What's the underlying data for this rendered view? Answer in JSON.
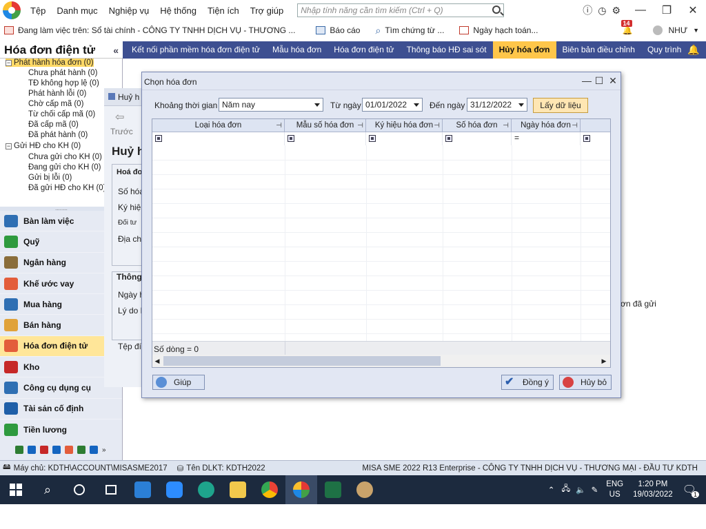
{
  "menubar": {
    "items": [
      "Tệp",
      "Danh mục",
      "Nghiệp vụ",
      "Hệ thống",
      "Tiện ích",
      "Trợ giúp"
    ],
    "search_placeholder": "Nhập tính năng cần tìm kiếm (Ctrl + Q)"
  },
  "toolbar": {
    "working_on": "Đang làm việc trên: Sổ tài chính - CÔNG TY TNHH DỊCH VỤ - THƯƠNG ...",
    "report": "Báo cáo",
    "find_voucher": "Tìm chứng từ ...",
    "posting_date": "Ngày hạch toán...",
    "notification_count": "14",
    "user": "NHƯ"
  },
  "left_panel": {
    "title": "Hóa đơn điện tử",
    "tree": [
      "Phát hành hóa đơn (0)",
      "Chưa phát hành (0)",
      "TĐ không hợp lệ (0)",
      "Phát hành lỗi (0)",
      "Chờ cấp mã (0)",
      "Từ chối cấp mã (0)",
      "Đã cấp mã (0)",
      "Đã phát hành (0)",
      "Gửi HĐ cho KH (0)",
      "Chưa gửi cho KH (0)",
      "Đang gửi cho KH (0)",
      "Gửi bị lỗi (0)",
      "Đã gửi HĐ cho KH (0)"
    ],
    "modules": [
      "Bàn làm việc",
      "Quỹ",
      "Ngân hàng",
      "Khế ước vay",
      "Mua hàng",
      "Bán hàng",
      "Hóa đơn điện tử",
      "Kho",
      "Công cụ dụng cụ",
      "Tài sản cố định",
      "Tiền lương"
    ]
  },
  "tabs": [
    "Kết nối phần mềm hóa đơn điện tử",
    "Mẫu hóa đơn",
    "Hóa đơn điện tử",
    "Thông báo HĐ sai sót",
    "Hủy hóa đơn",
    "Biên bản điều chỉnh",
    "Quy trình"
  ],
  "background_form": {
    "title": "Huỷ h",
    "back": "Trước",
    "heading": "Huỷ h",
    "group1": "Hoá đơ",
    "labels1": [
      "Số hóa",
      "Ký hiệ",
      "Đối tư",
      "Địa ch"
    ],
    "group2": "Thông",
    "labels2": [
      "Ngày h",
      "Lý do h"
    ],
    "label3": "Tệp đí",
    "right_text": "ơn đã gửi"
  },
  "dialog": {
    "title": "Chọn hóa đơn",
    "period_label": "Khoảng thời gian",
    "period_value": "Năm nay",
    "from_label": "Từ ngày",
    "from_value": "01/01/2022",
    "to_label": "Đến ngày",
    "to_value": "31/12/2022",
    "load_button": "Lấy dữ liệu",
    "columns": [
      "Loại hóa đơn",
      "Mẫu số hóa đơn",
      "Ký hiệu hóa đơn",
      "Số hóa đơn",
      "Ngày hóa đơn"
    ],
    "row_count": "Số dòng = 0",
    "help_button": "Giúp",
    "ok_button": "Đồng ý",
    "cancel_button": "Hủy bỏ"
  },
  "statusbar": {
    "server": "Máy chủ: KDTH\\ACCOUNT\\MISASME2017",
    "db": "Tên DLKT: KDTH2022",
    "product": "MISA SME 2022 R13 Enterprise - CÔNG TY TNHH DỊCH VỤ - THƯƠNG MẠI - ĐẦU TƯ KDTH"
  },
  "taskbar": {
    "lang": "ENG",
    "region": "US",
    "time": "1:20 PM",
    "date": "19/03/2022",
    "notif": "1"
  }
}
